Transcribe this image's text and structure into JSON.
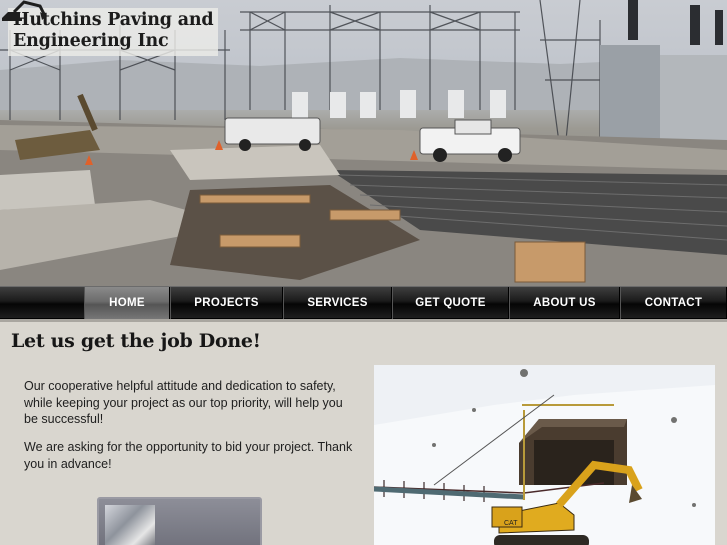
{
  "header": {
    "company_line1": "Hutchins Paving and",
    "company_line2": "Engineering Inc"
  },
  "hero_image": {
    "icon": "construction-site-photo"
  },
  "nav": {
    "items": [
      {
        "label": "HOME",
        "active": true
      },
      {
        "label": "PROJECTS",
        "active": false
      },
      {
        "label": "SERVICES",
        "active": false
      },
      {
        "label": "GET QUOTE",
        "active": false
      },
      {
        "label": "ABOUT US",
        "active": false
      },
      {
        "label": "CONTACT",
        "active": false
      }
    ]
  },
  "main": {
    "headline": "Let us get the job Done!",
    "paragraph1": "Our cooperative helpful attitude and dedication to safety, while keeping your project as our top priority, will help you be successful!",
    "paragraph2": "We are asking for the opportunity to bid your project. Thank you in advance!"
  },
  "colors": {
    "page_background": "#d9d6cf",
    "nav_background": "#111111",
    "nav_active": "#6e6e6e",
    "nav_text": "#ffffff",
    "excavator_yellow": "#d9a21b"
  }
}
